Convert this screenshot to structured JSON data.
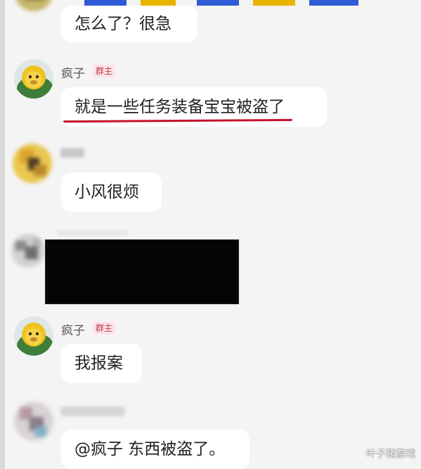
{
  "messages": [
    {
      "text": "怎么了？很急"
    },
    {
      "sender": "疯子",
      "badge": "群主",
      "text": "就是一些任务装备宝宝被盗了"
    },
    {
      "text": "小风很烦"
    },
    {
      "sender": "疯子",
      "badge": "群主",
      "text": "我报案"
    },
    {
      "text": "@疯子 东西被盗了。"
    }
  ],
  "watermark": "叶子猪游戏",
  "colors": {
    "background": "#f4f4f4",
    "bubble": "#ffffff",
    "badge_text": "#c0394b",
    "badge_bg": "#fbe3e6",
    "underline": "#c4122b"
  },
  "icons": {
    "owner_avatar": "lion-cartoon-avatar",
    "blurred_avatar": "pixelated-avatar"
  }
}
